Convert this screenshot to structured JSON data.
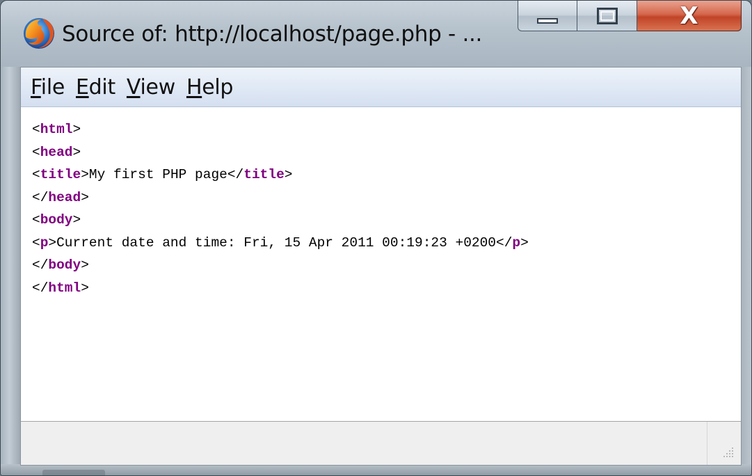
{
  "window": {
    "title": "Source of: http://localhost/page.php - ...",
    "app_icon": "firefox-icon",
    "controls": {
      "minimize": "minimize-icon",
      "maximize": "maximize-icon",
      "close": "close-icon",
      "close_glyph": "X"
    }
  },
  "menu": {
    "items": [
      {
        "mnemonic": "F",
        "rest": "ile"
      },
      {
        "mnemonic": "E",
        "rest": "dit"
      },
      {
        "mnemonic": "V",
        "rest": "iew"
      },
      {
        "mnemonic": "H",
        "rest": "elp"
      }
    ]
  },
  "source": {
    "lines": [
      [
        {
          "t": "<"
        },
        {
          "t": "html",
          "tag": true
        },
        {
          "t": ">"
        }
      ],
      [
        {
          "t": "<"
        },
        {
          "t": "head",
          "tag": true
        },
        {
          "t": ">"
        }
      ],
      [
        {
          "t": "<"
        },
        {
          "t": "title",
          "tag": true
        },
        {
          "t": ">My first PHP page</"
        },
        {
          "t": "title",
          "tag": true
        },
        {
          "t": ">"
        }
      ],
      [
        {
          "t": "</"
        },
        {
          "t": "head",
          "tag": true
        },
        {
          "t": ">"
        }
      ],
      [
        {
          "t": "<"
        },
        {
          "t": "body",
          "tag": true
        },
        {
          "t": ">"
        }
      ],
      [
        {
          "t": "<"
        },
        {
          "t": "p",
          "tag": true
        },
        {
          "t": ">Current date and time: Fri, 15 Apr 2011 00:19:23 +0200</"
        },
        {
          "t": "p",
          "tag": true
        },
        {
          "t": ">"
        }
      ],
      [
        {
          "t": "</"
        },
        {
          "t": "body",
          "tag": true
        },
        {
          "t": ">"
        }
      ],
      [
        {
          "t": "</"
        },
        {
          "t": "html",
          "tag": true
        },
        {
          "t": ">"
        }
      ]
    ]
  },
  "statusbar": {
    "text": "",
    "grip_icon": "resize-grip-icon"
  },
  "colors": {
    "tag": "#800080",
    "close_button": "#c84a2c",
    "menubar": "#dfe8f5"
  }
}
